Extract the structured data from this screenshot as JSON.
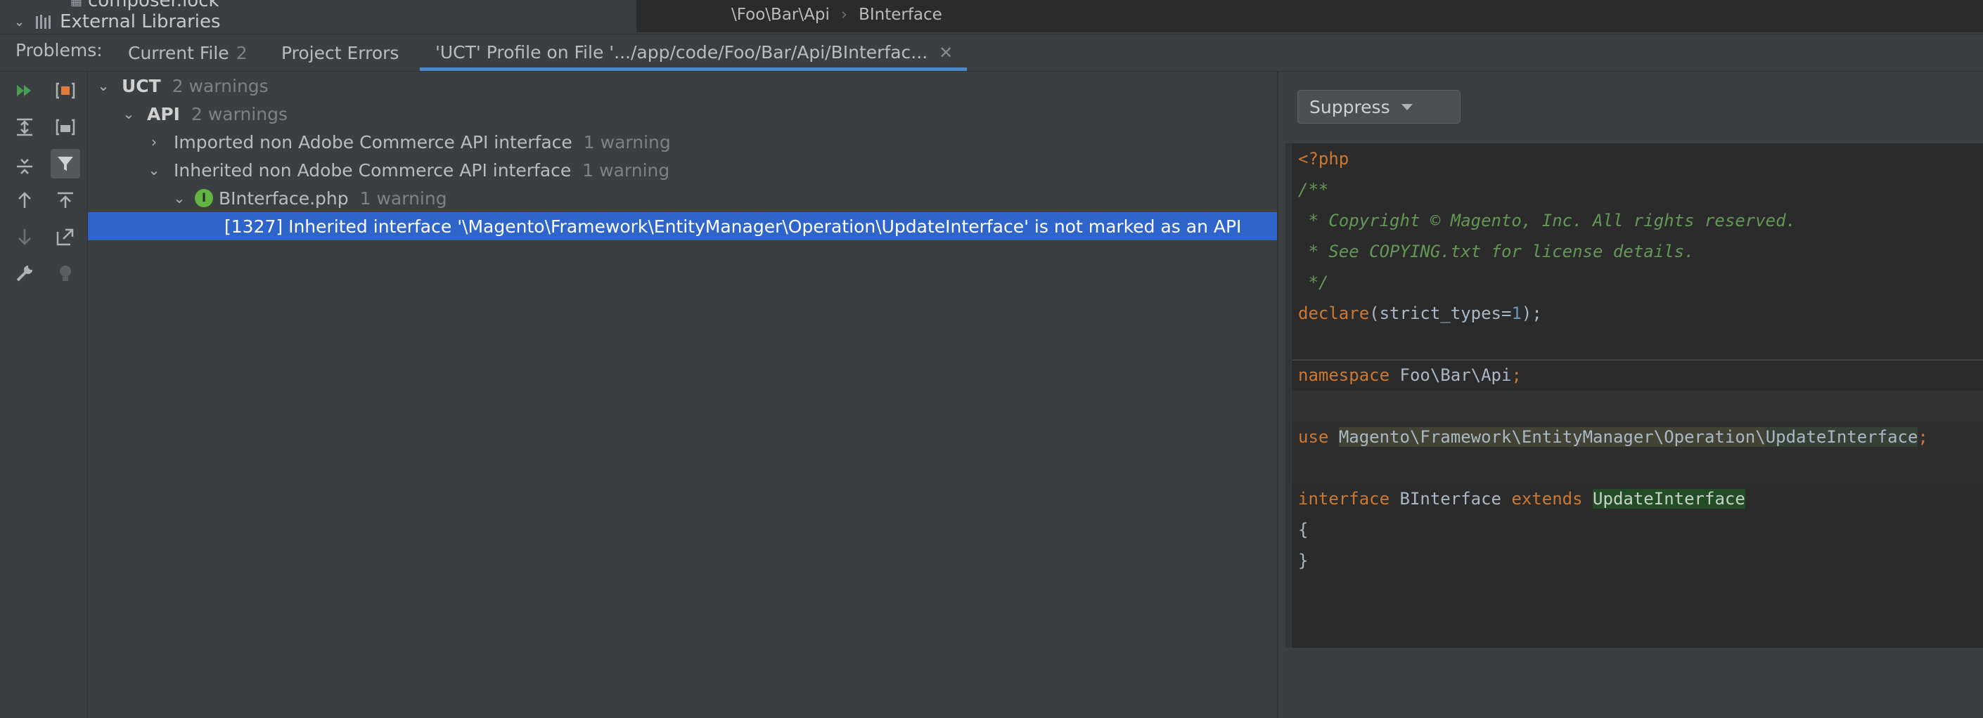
{
  "project_panel": {
    "row1_label": "composer.lock",
    "row2_label": "External Libraries"
  },
  "breadcrumb": {
    "part1": "\\Foo\\Bar\\Api",
    "sep": "›",
    "part2": "BInterface"
  },
  "problems": {
    "label": "Problems:",
    "tabs": [
      {
        "label": "Current File",
        "count": "2"
      },
      {
        "label": "Project Errors"
      },
      {
        "label": "'UCT' Profile on File '.../app/code/Foo/Bar/Api/BInterfac...",
        "close": "✕"
      }
    ]
  },
  "toolbar_icons": [
    "rerun-icon",
    "export-icon",
    "expand-all-icon",
    "preview-icon",
    "collapse-all-icon",
    "filter-icon",
    "previous-icon",
    "autoscroll-icon",
    "next-icon",
    "jump-to-source-icon",
    "settings-icon",
    "quickfix-icon"
  ],
  "tree": {
    "root": {
      "label": "UCT",
      "meta": "2 warnings"
    },
    "group": {
      "label": "API",
      "meta": "2 warnings"
    },
    "item1": {
      "label": "Imported non Adobe Commerce API interface",
      "meta": "1 warning"
    },
    "item2": {
      "label": "Inherited non Adobe Commerce API interface",
      "meta": "1 warning"
    },
    "file": {
      "label": "BInterface.php",
      "meta": "1 warning",
      "icon_letter": "I"
    },
    "problem": {
      "label": "[1327] Inherited interface '\\Magento\\Framework\\EntityManager\\Operation\\UpdateInterface' is not marked as an API"
    }
  },
  "suppress": {
    "label": "Suppress"
  },
  "code": {
    "l1": "<?php",
    "l2": "/**",
    "l3": " * Copyright © Magento, Inc. All rights reserved.",
    "l4": " * See COPYING.txt for license details.",
    "l5": " */",
    "l6_kw": "declare",
    "l6_a": "(strict_types=",
    "l6_num": "1",
    "l6_b": ");",
    "l8_kw": "namespace",
    "l8_rest": " Foo\\Bar\\Api",
    "l8_semi": ";",
    "l10_kw": "use",
    "l10_ns": "Magento\\Framework\\EntityManager\\Operation\\",
    "l10_cls": "UpdateInterface",
    "l10_semi": ";",
    "l12_kw": "interface",
    "l12_name": " BInterface ",
    "l12_ext": "extends",
    "l12_parent": "UpdateInterface",
    "l13": "{",
    "l14": "}"
  },
  "colors": {
    "selection": "#2f65ca",
    "tab_underline": "#4a88c7",
    "keyword": "#cc7832",
    "comment": "#629755",
    "number": "#6897bb"
  }
}
